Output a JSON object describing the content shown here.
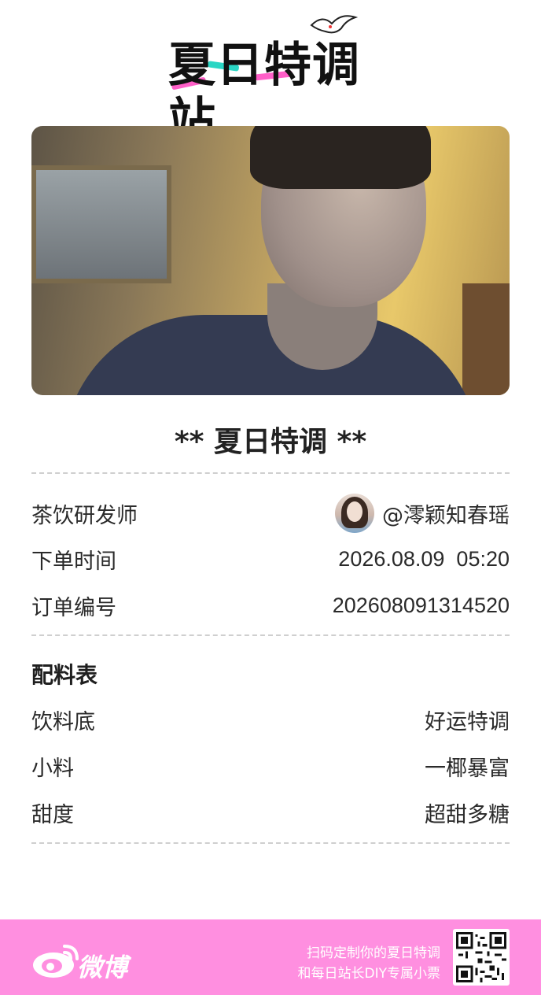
{
  "logo": {
    "text": "夏日特调站"
  },
  "title": "** 夏日特调 **",
  "info": {
    "developer_label": "茶饮研发师",
    "developer_name": "@澪颖知春瑶",
    "order_time_label": "下单时间",
    "order_time_value": "2026.08.09  05:20",
    "order_no_label": "订单编号",
    "order_no_value": "202608091314520"
  },
  "recipe": {
    "title": "配料表",
    "items": [
      {
        "label": "饮料底",
        "value": "好运特调"
      },
      {
        "label": "小料",
        "value": "一椰暴富"
      },
      {
        "label": "甜度",
        "value": "超甜多糖"
      }
    ]
  },
  "footer": {
    "brand": "微博",
    "line1": "扫码定制你的夏日特调",
    "line2": "和每日站长DIY专属小票",
    "bg_color": "#ff8fe0"
  },
  "icons": {
    "logo_bird": "bird-icon",
    "weibo": "weibo-eye-icon",
    "qr": "qr-code-icon"
  }
}
